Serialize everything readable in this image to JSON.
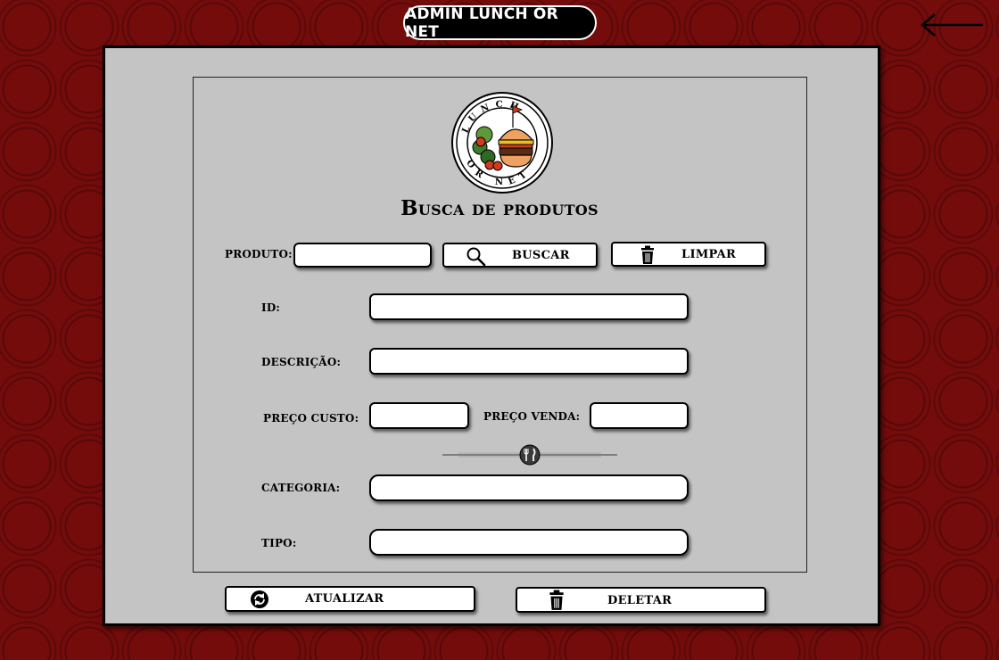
{
  "header": {
    "title": "ADMIN LUNCH OR NET"
  },
  "logo": {
    "ring_text_top": "LUNCH",
    "ring_text_bottom": "OR NET"
  },
  "page": {
    "title": "Busca de produtos"
  },
  "search": {
    "label": "PRODUTO:",
    "value": "",
    "search_button": "BUSCAR",
    "clear_button": "LIMPAR"
  },
  "form": {
    "id_label": "ID:",
    "id_value": "",
    "descricao_label": "DESCRIÇÃO:",
    "descricao_value": "",
    "preco_custo_label": "PREÇO CUSTO:",
    "preco_custo_value": "",
    "preco_venda_label": "PREÇO VENDA:",
    "preco_venda_value": "",
    "categoria_label": "CATEGORIA:",
    "categoria_value": "",
    "tipo_label": "TIPO:",
    "tipo_value": ""
  },
  "actions": {
    "update_button": "ATUALIZAR",
    "delete_button": "DELETAR"
  },
  "colors": {
    "background": "#750c0c",
    "panel": "#c4c4c4",
    "accent": "#000000"
  }
}
